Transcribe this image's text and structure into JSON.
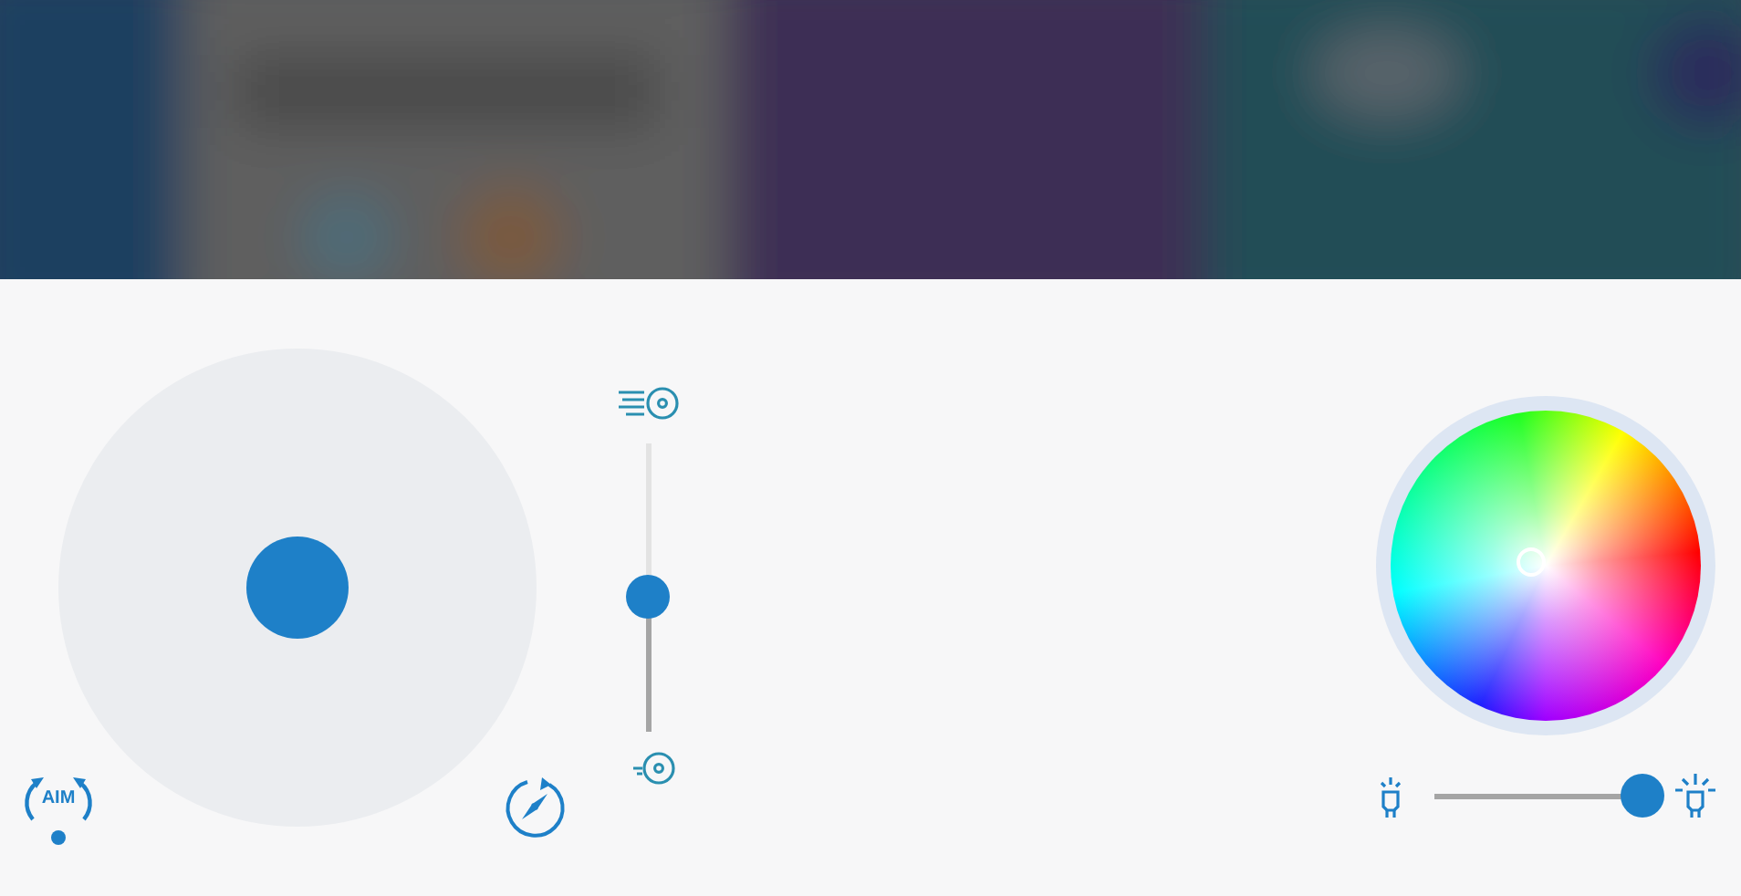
{
  "aim_button": {
    "label": "AIM"
  },
  "speed_slider": {
    "level": 0.47
  },
  "brightness_slider": {
    "level": 0.95
  }
}
